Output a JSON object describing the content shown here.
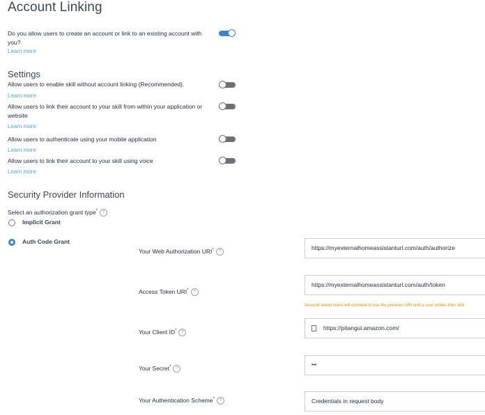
{
  "account_linking": {
    "title": "Account Linking",
    "question": "Do you allow users to create an account or link to an existing account with you?",
    "learn_more": "Learn more",
    "toggle_state": "on"
  },
  "settings": {
    "title": "Settings",
    "items": [
      {
        "label": "Allow users to enable skill without account linking (Recommended).",
        "learn_more": "Learn more",
        "state": "off"
      },
      {
        "label": "Allow users to link their account to your skill from within your application or website",
        "learn_more": "Learn more",
        "state": "off"
      },
      {
        "label": "Allow users to authenticate using your mobile application",
        "learn_more": "Learn more",
        "state": "off"
      },
      {
        "label": "Allow users to link their account to your skill using voice",
        "learn_more": "Learn more",
        "state": "off"
      }
    ]
  },
  "security": {
    "title": "Security Provider Information",
    "grant_type_label": "Select an authorization grant type",
    "required_mark": "*",
    "help_mark": "?",
    "grant_options": [
      {
        "label": "Implicit Grant",
        "selected": false
      },
      {
        "label": "Auth Code Grant",
        "selected": true
      }
    ],
    "fields": {
      "web_auth_uri": {
        "label": "Your Web Authorization URI",
        "value": "https://myexternalhomeassistanturl.com/auth/authorize"
      },
      "access_token_uri": {
        "label": "Access Token URI",
        "value": "https://myexternalhomeassistanturl.com/auth/token",
        "warning": "Account linked users will continue to use the previous URI until a user relinks their skill"
      },
      "client_id": {
        "label": "Your Client ID",
        "value": "https://pitangui.amazon.com/"
      },
      "secret": {
        "label": "Your Secret",
        "value": "•••"
      },
      "auth_scheme": {
        "label": "Your Authentication Scheme",
        "value": "Credentials in request body"
      }
    }
  },
  "colors": {
    "accent": "#3d85c6",
    "link": "#5aa0d0",
    "warning": "#e88d00"
  }
}
